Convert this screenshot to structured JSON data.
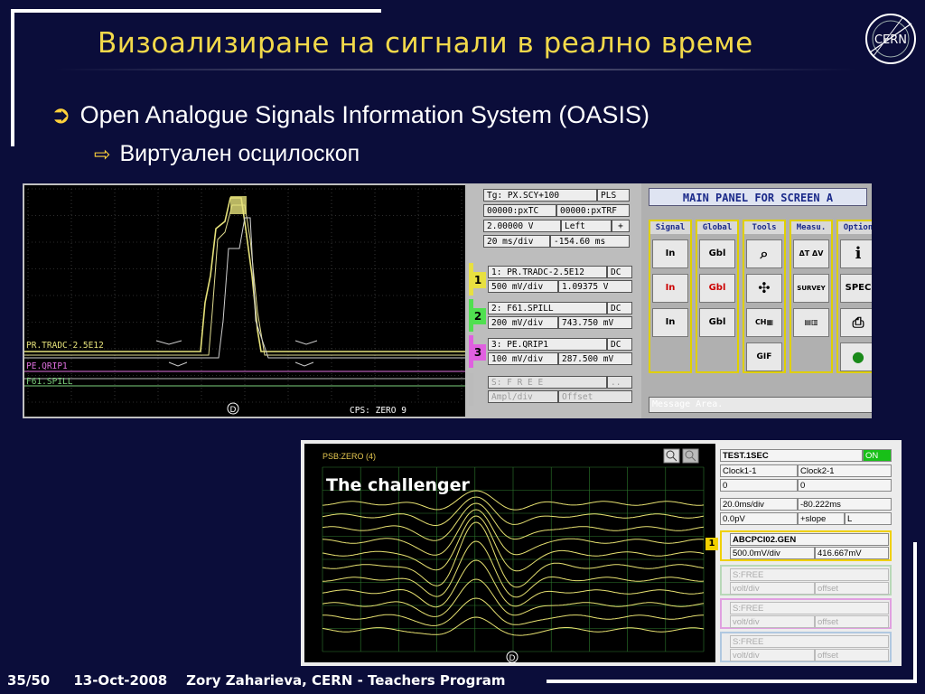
{
  "slide": {
    "title": "Визоализиране на сигнали в реално време",
    "bullet1": "Open Analogue Signals Information System (OASIS)",
    "bullet2": "Виртуален осцилоскоп",
    "footer": "35/50     13-Oct-2008    Zory Zaharieva, CERN - Teachers Program",
    "logo_text": "CERN"
  },
  "scope1": {
    "trace_labels": [
      "PR.TRADC-2.5E12",
      "PE.QRIP1",
      "F61.SPILL"
    ],
    "status": "CPS: ZERO 9",
    "trigger_marker": "D",
    "colors": {
      "yellow": "#e6e27a",
      "magenta": "#e070e0",
      "green": "#7cd07c",
      "white": "#d8d8d8"
    }
  },
  "controls1": {
    "trigger": {
      "name": "Tg: PX.SCY+100",
      "mode": "PLS",
      "src1": "00000:pxTC",
      "src2": "00000:pxTRF",
      "level": "2.00000 V",
      "slope": "Left",
      "sign": "+",
      "timebase": "20 ms/div",
      "delay": "-154.60 ms"
    },
    "channels": [
      {
        "num": "1",
        "name": "1: PR.TRADC-2.5E12",
        "coupling": "DC",
        "scale": "500 mV/div",
        "offset": "1.09375 V",
        "color": "#e8e040"
      },
      {
        "num": "2",
        "name": "2: F61.SPILL",
        "coupling": "DC",
        "scale": "200 mV/div",
        "offset": "743.750 mV",
        "color": "#50e050"
      },
      {
        "num": "3",
        "name": "3: PE.QRIP1",
        "coupling": "DC",
        "scale": "100 mV/div",
        "offset": "287.500 mV",
        "color": "#e060e0"
      },
      {
        "num": "",
        "name": "S:   F R E E",
        "coupling": "..",
        "scale": "Ampl/div",
        "offset": "Offset",
        "color": "#bbbbbb"
      }
    ]
  },
  "main_panel": {
    "header": "MAIN PANEL FOR SCREEN A",
    "columns": [
      "Signal",
      "Global",
      "Tools",
      "Measu.",
      "Option"
    ],
    "buttons": {
      "signal": [
        "In",
        "In",
        "In"
      ],
      "global": [
        "Gbl",
        "Gbl",
        "Gbl"
      ],
      "tools": [
        "zoom",
        "cursors",
        "ch",
        "GIF"
      ],
      "measu": [
        "ΔT ΔV",
        "SURVEY",
        "PREF"
      ],
      "option": [
        "i",
        "SPEC",
        "print",
        "light"
      ]
    },
    "message": "Message Area."
  },
  "scope2": {
    "title": "PSB:ZERO (4)",
    "overlay": "The challenger",
    "trigger_marker": "D",
    "marker": "1"
  },
  "controls2": {
    "signal": "TEST.1SEC",
    "state": "ON",
    "clock1": "Clock1-1",
    "clock2": "Clock2-1",
    "v1": "0",
    "v2": "0",
    "timebase": "20.0ms/div",
    "delay": "-80.222ms",
    "level": "0.0pV",
    "slope": "+slope",
    "slope_side": "L",
    "channel_name": "ABCPCI02.GEN",
    "channel_scale": "500.0mV/div",
    "channel_offset": "416.667mV",
    "free_slots": [
      {
        "name": "S:FREE",
        "scale": "volt/div",
        "offset": "offset",
        "color": "#b8d8b8"
      },
      {
        "name": "S:FREE",
        "scale": "volt/div",
        "offset": "offset",
        "color": "#e0a0e0"
      },
      {
        "name": "S:FREE",
        "scale": "volt/div",
        "offset": "offset",
        "color": "#b0c8e0"
      }
    ]
  }
}
